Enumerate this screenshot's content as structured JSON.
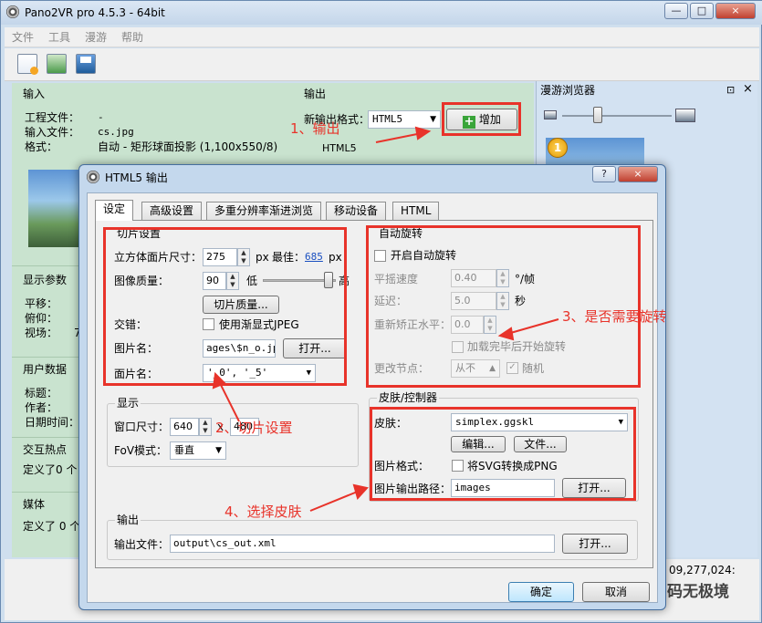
{
  "window": {
    "title": "Pano2VR pro 4.5.3 - 64bit"
  },
  "menu": [
    "文件",
    "工具",
    "漫游",
    "帮助"
  ],
  "toolbar": [
    "new-icon",
    "open-icon",
    "save-icon"
  ],
  "input_panel": {
    "title": "输入",
    "project_label": "工程文件：",
    "project_value": "-",
    "input_label": "输入文件：",
    "input_value": "cs.jpg",
    "format_label": "格式：",
    "format_value": "自动 - 矩形球面投影 (1,100x550/8)"
  },
  "display_params": {
    "title": "显示参数",
    "pan": "平移：",
    "tilt": "俯仰：",
    "fov": "视场：",
    "fov_value": "7"
  },
  "user_data": {
    "title": "用户数据",
    "title_label": "标题：",
    "author_label": "作者：",
    "date_label": "日期时间："
  },
  "hotspots": {
    "title": "交互热点",
    "text": "定义了0 个"
  },
  "media": {
    "title": "媒体",
    "text": "定义了 0 个"
  },
  "output_panel": {
    "title": "输出",
    "new_format_label": "新输出格式：",
    "format_value": "HTML5",
    "add_button": "增加",
    "html5_item": "HTML5"
  },
  "tour_browser": {
    "title": "漫游浏览器",
    "badge": "1",
    "pin": "⊡",
    "close": "×"
  },
  "status": {
    "coords": "09,277,024:",
    "watermark": "码无极境"
  },
  "dialog": {
    "title": "HTML5 输出",
    "help_btn": "?",
    "close_btn": "×",
    "tabs": [
      "设定",
      "高级设置",
      "多重分辨率渐进浏览",
      "移动设备",
      "HTML"
    ],
    "tiles": {
      "title": "切片设置",
      "cube_label": "立方体面片尺寸：",
      "cube_value": "275",
      "cube_unit": "px",
      "best_label": "最佳：",
      "best_value": "685",
      "best_unit": "px",
      "quality_label": "图像质量：",
      "quality_value": "90",
      "low": "低",
      "high": "高",
      "quality_level": 0.9,
      "quality_button": "切片质量...",
      "interlace_label": "交错：",
      "interlace_check": "使用渐显式JPEG",
      "imgname_label": "图片名：",
      "imgname_value": "ages\\$n_o.jpg",
      "open_button": "打开...",
      "facename_label": "面片名：",
      "facename_value": "'_0', '_5'"
    },
    "display": {
      "title": "显示",
      "size_label": "窗口尺寸：",
      "width": "640",
      "x": "x",
      "height": "480",
      "fov_label": "FoV模式：",
      "fov_value": "垂直"
    },
    "autorotate": {
      "title": "自动旋转",
      "enable": "开启自动旋转",
      "speed_label": "平摇速度",
      "speed_value": "0.40",
      "speed_unit": "°/帧",
      "delay_label": "延迟：",
      "delay_value": "5.0",
      "delay_unit": "秒",
      "level_label": "重新矫正水平：",
      "level_value": "0.0",
      "after_load": "加载完毕后开始旋转",
      "node_label": "更改节点：",
      "node_value": "从不",
      "random": "随机"
    },
    "skin": {
      "title": "皮肤/控制器",
      "skin_label": "皮肤：",
      "skin_value": "simplex.ggskl",
      "edit_button": "编辑...",
      "file_button": "文件...",
      "imgfmt_label": "图片格式：",
      "svg_check": "将SVG转换成PNG",
      "path_label": "图片输出路径：",
      "path_value": "images",
      "open_button": "打开..."
    },
    "output": {
      "title": "输出",
      "file_label": "输出文件：",
      "file_value": "output\\cs_out.xml",
      "open_button": "打开..."
    },
    "ok": "确定",
    "cancel": "取消"
  },
  "annotations": {
    "a1": "1、输出",
    "a2": "2、切片设置",
    "a3": "3、是否需要旋转",
    "a4": "4、选择皮肤"
  },
  "colors": {
    "annotation": "#e8332a",
    "accent": "#1f5c9a"
  }
}
